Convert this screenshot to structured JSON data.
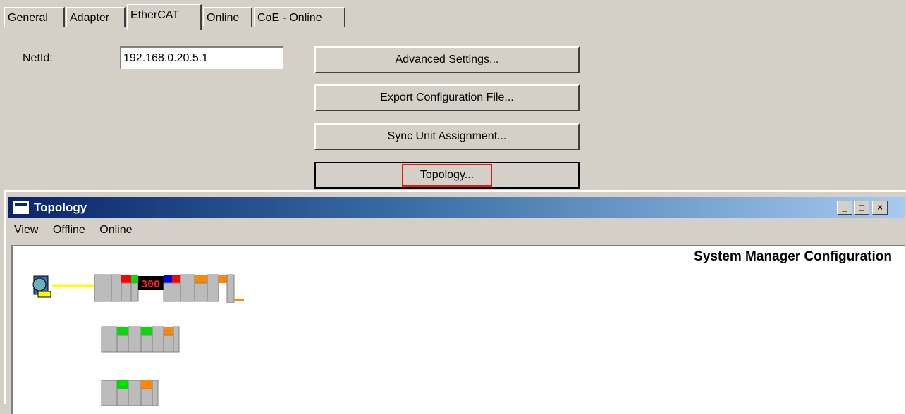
{
  "tabs": [
    {
      "label": "General"
    },
    {
      "label": "Adapter"
    },
    {
      "label": "EtherCAT",
      "active": true
    },
    {
      "label": "Online"
    },
    {
      "label": "CoE - Online"
    }
  ],
  "form": {
    "netid_label": "NetId:",
    "netid_value": "192.168.0.20.5.1"
  },
  "buttons": {
    "advanced": "Advanced Settings...",
    "export": "Export Configuration File...",
    "sync": "Sync Unit Assignment...",
    "topology": "Topology..."
  },
  "topology_window": {
    "title": "Topology",
    "menu": [
      "View",
      "Offline",
      "Online"
    ],
    "config_title": "System Manager Configuration",
    "display_value": "300",
    "controls": {
      "minimize": "_",
      "maximize": "□",
      "close": "×"
    }
  },
  "colors": {
    "title_dark": "#0a246a",
    "title_light": "#a6caf0",
    "highlight": "#e01a1a",
    "terminal_red": "#ff0000",
    "terminal_green": "#00dd00",
    "terminal_blue": "#0000ee",
    "terminal_orange": "#ff8800",
    "ethernet_line": "#ffff00"
  }
}
